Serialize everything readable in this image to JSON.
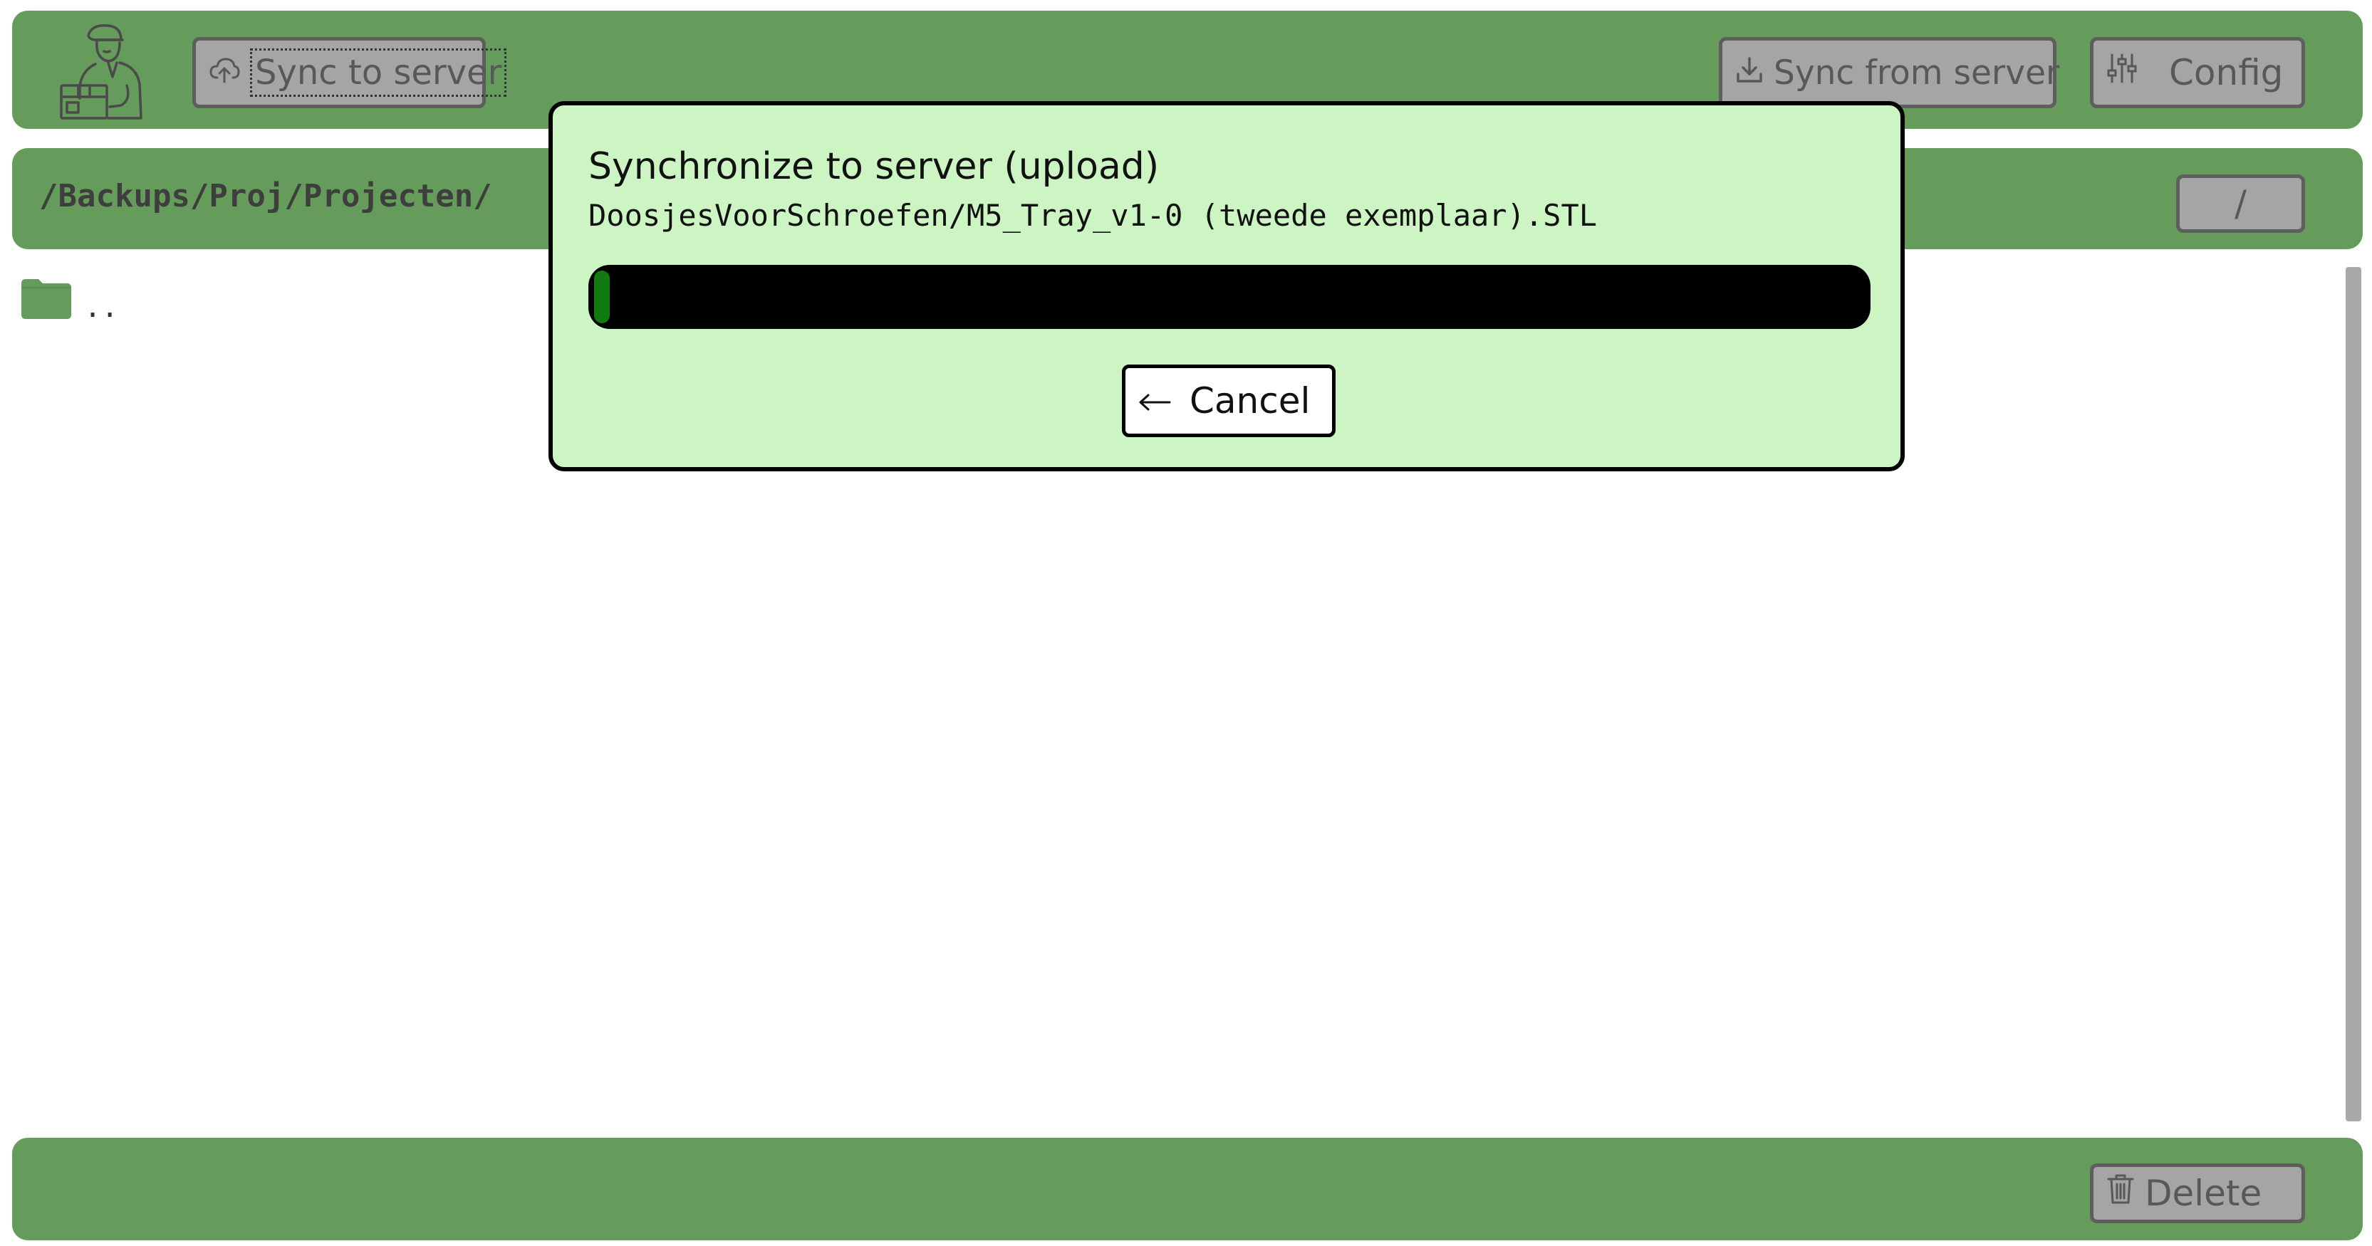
{
  "toolbar": {
    "sync_to_label": "Sync to server",
    "sync_from_label": "Sync from server",
    "config_label": "Config"
  },
  "path": {
    "current": "/Backups/Proj/Projecten/",
    "root_label": "/"
  },
  "file_list": {
    "items": [
      {
        "name": "..",
        "icon": "folder-icon"
      }
    ]
  },
  "dialog": {
    "title": "Synchronize to server (upload)",
    "file": "DoosjesVoorSchroefen/M5_Tray_v1-0 (tweede exemplaar).STL",
    "progress": 0.01,
    "cancel_label": "Cancel"
  },
  "footer": {
    "delete_label": "Delete"
  },
  "colors": {
    "bar": "#669c5b",
    "button": "#a5a5a5",
    "dialog": "#cdf5c3",
    "progress_track": "#000000",
    "progress_fill": "#117a11",
    "folder": "#669c5b"
  }
}
